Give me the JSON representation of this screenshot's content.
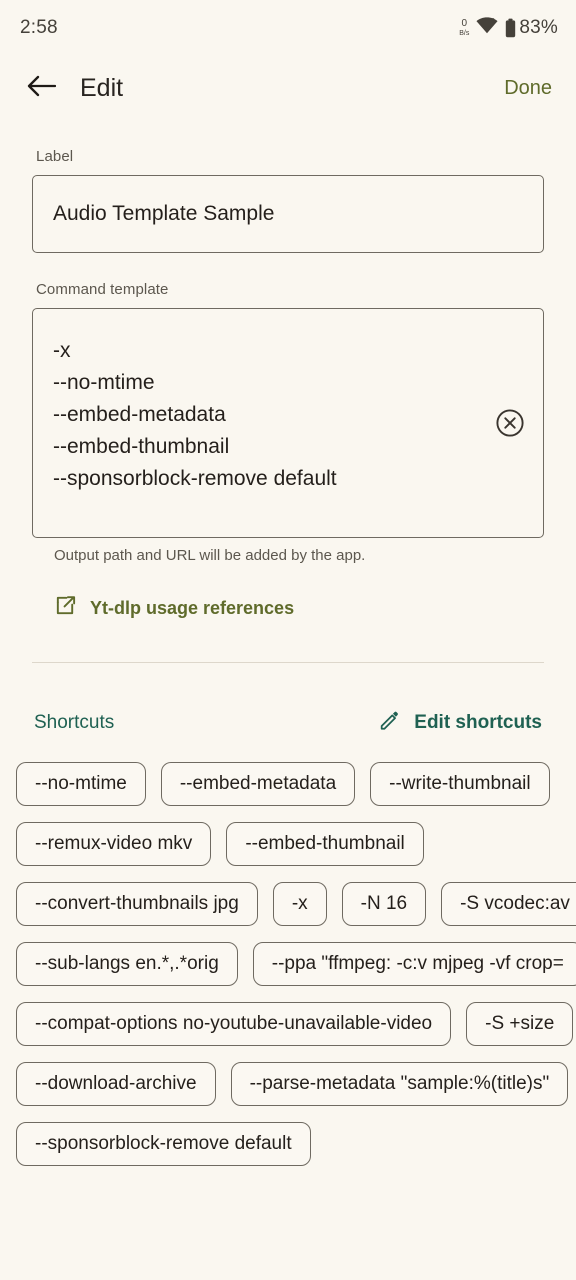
{
  "status_bar": {
    "time": "2:58",
    "net_speed_value": "0",
    "net_speed_unit": "B/s",
    "wifi_icon": "wifi-icon",
    "battery_icon": "battery-icon",
    "battery_percent": "83%"
  },
  "app_bar": {
    "back_icon": "back-arrow-icon",
    "title": "Edit",
    "done_label": "Done"
  },
  "form": {
    "label_field_label": "Label",
    "label_field_value": "Audio Template Sample",
    "label_field_placeholder": "Label",
    "command_field_label": "Command template",
    "command_field_lines": [
      "-x",
      "--no-mtime",
      "--embed-metadata",
      "--embed-thumbnail",
      "--sponsorblock-remove default"
    ],
    "command_field_value": "-x\n--no-mtime\n--embed-metadata\n--embed-thumbnail\n--sponsorblock-remove default",
    "command_field_placeholder": "Command template",
    "clear_icon": "clear-circle-icon",
    "helper_text": "Output path and URL will be added by the app.",
    "reference_link_icon": "open-in-new-icon",
    "reference_link_label": "Yt-dlp usage references"
  },
  "shortcuts": {
    "title": "Shortcuts",
    "edit_icon": "pencil-icon",
    "edit_label": "Edit shortcuts",
    "rows": [
      [
        "--no-mtime",
        "--embed-metadata",
        "--write-thumbnail"
      ],
      [
        "--remux-video mkv",
        "--embed-thumbnail"
      ],
      [
        "--convert-thumbnails jpg",
        "-x",
        "-N 16",
        "-S vcodec:av"
      ],
      [
        "--sub-langs en.*,.*orig",
        "--ppa \"ffmpeg: -c:v mjpeg -vf crop="
      ],
      [
        "--compat-options no-youtube-unavailable-video",
        "-S +size"
      ],
      [
        "--download-archive",
        "--parse-metadata \"sample:%(title)s\""
      ],
      [
        "--sponsorblock-remove default"
      ]
    ]
  },
  "colors": {
    "background": "#faf7f0",
    "accent_olive": "#5f6b2b",
    "accent_teal": "#1f6152",
    "text_primary": "#241f1b",
    "text_secondary": "#5c574e",
    "border": "#6f6a61"
  }
}
